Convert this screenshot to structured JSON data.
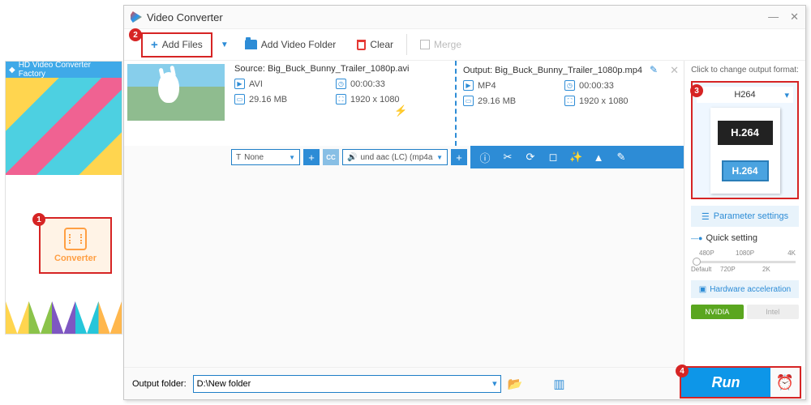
{
  "back": {
    "title": "HD Video Converter Factory",
    "tile_label": "Converter"
  },
  "badges": {
    "b1": "1",
    "b2": "2",
    "b3": "3",
    "b4": "4"
  },
  "main": {
    "title": "Video Converter",
    "toolbar": {
      "add_files": "Add Files",
      "add_folder": "Add Video Folder",
      "clear": "Clear",
      "merge": "Merge"
    },
    "file": {
      "source_label": "Source: Big_Buck_Bunny_Trailer_1080p.avi",
      "output_label": "Output: Big_Buck_Bunny_Trailer_1080p.mp4",
      "src": {
        "fmt": "AVI",
        "dur": "00:00:33",
        "size": "29.16 MB",
        "res": "1920 x 1080"
      },
      "out": {
        "fmt": "MP4",
        "dur": "00:00:33",
        "size": "29.16 MB",
        "res": "1920 x 1080"
      }
    },
    "actbar": {
      "subtitle": "None",
      "audio": "und aac (LC) (mp4a"
    },
    "right": {
      "header": "Click to change output format:",
      "sel": "H264",
      "card1": "H.264",
      "card2": "H.264",
      "param": "Parameter settings",
      "quick": "Quick setting",
      "hw": "Hardware acceleration",
      "nvidia": "NVIDIA",
      "intel": "Intel",
      "ticks": {
        "p480": "480P",
        "p720": "720P",
        "p1080": "1080P",
        "p2k": "2K",
        "p4k": "4K",
        "def": "Default"
      }
    },
    "bottom": {
      "label": "Output folder:",
      "path": "D:\\New folder",
      "run": "Run"
    }
  }
}
